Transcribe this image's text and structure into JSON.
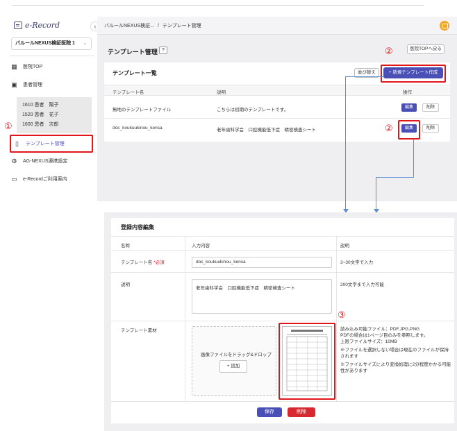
{
  "app": {
    "logo_text": "e-Record"
  },
  "sidebar": {
    "clinic_select_value": "バルールNEXUS検証医院 1",
    "items": [
      {
        "label": "医院TOP",
        "icon": "grid-icon"
      },
      {
        "label": "患者管理",
        "icon": "patient-card-icon"
      },
      {
        "label": "テンプレート管理",
        "icon": "document-icon"
      },
      {
        "label": "AG-NEXUS連携設定",
        "icon": "gear-icon"
      },
      {
        "label": "e-Recordご利用案内",
        "icon": "window-icon"
      }
    ],
    "patients": [
      "1610 患者　陽子",
      "1520 患者　花子",
      "1600 患者　次郎"
    ]
  },
  "header": {
    "breadcrumb_parent": "バルールNEXUS検証...",
    "breadcrumb_sep": "/",
    "breadcrumb_current": "テンプレート管理"
  },
  "template_page": {
    "title": "テンプレート管理",
    "help": "?",
    "clinic_top_button": "医院TOPへ戻る",
    "list_title": "テンプレート一覧",
    "sort_button": "並び替え",
    "new_button": "+ 新規テンプレート作成",
    "columns": [
      "テンプレート名",
      "説明",
      "操作"
    ],
    "rows": [
      {
        "name": "無地のテンプレートファイル",
        "desc": "こちらは初期のテンプレートです。",
        "edit": "編集",
        "delete": "削除"
      },
      {
        "name": "doc_koukuukinou_kensa",
        "desc": "老年歯科学会　口腔機能低下症　精密検査シート",
        "edit": "編集",
        "delete": "削除"
      }
    ]
  },
  "edit_form": {
    "title": "登録内容編集",
    "col_name": "名称",
    "col_input": "入力内容",
    "col_desc": "説明",
    "name_label": "テンプレート名",
    "required_mark": "*必須",
    "name_value": "doc_koukuukinou_kensa",
    "name_hint": "3~30文字で入力",
    "desc_label": "説明",
    "desc_value": "老年歯科学会　口腔機能低下症　精密検査シート",
    "desc_hint": "200文字まで入力可能",
    "material_label": "テンプレート素材",
    "dropzone_text": "画像ファイルをドラッグ&ドロップ",
    "add_button": "+ 追加",
    "material_hints": [
      "読み込み可能ファイル：PDF,JPG,PNG",
      "PDFの場合は1ページ目のみを参照します。",
      "上限ファイルサイズ：10MB",
      "※ファイルを選択しない場合は現在のファイルが保持されます",
      "※ファイルサイズにより変換処理に2分程度かかる可能性があります"
    ],
    "save_button": "保存",
    "delete_button": "削除"
  },
  "annotations": {
    "one": "①",
    "two": "②",
    "three": "③"
  },
  "colors": {
    "primary": "#4a4fb6",
    "danger": "#d62a30",
    "annotation_red": "#e0161b",
    "connector_blue": "#5b8fd6"
  }
}
